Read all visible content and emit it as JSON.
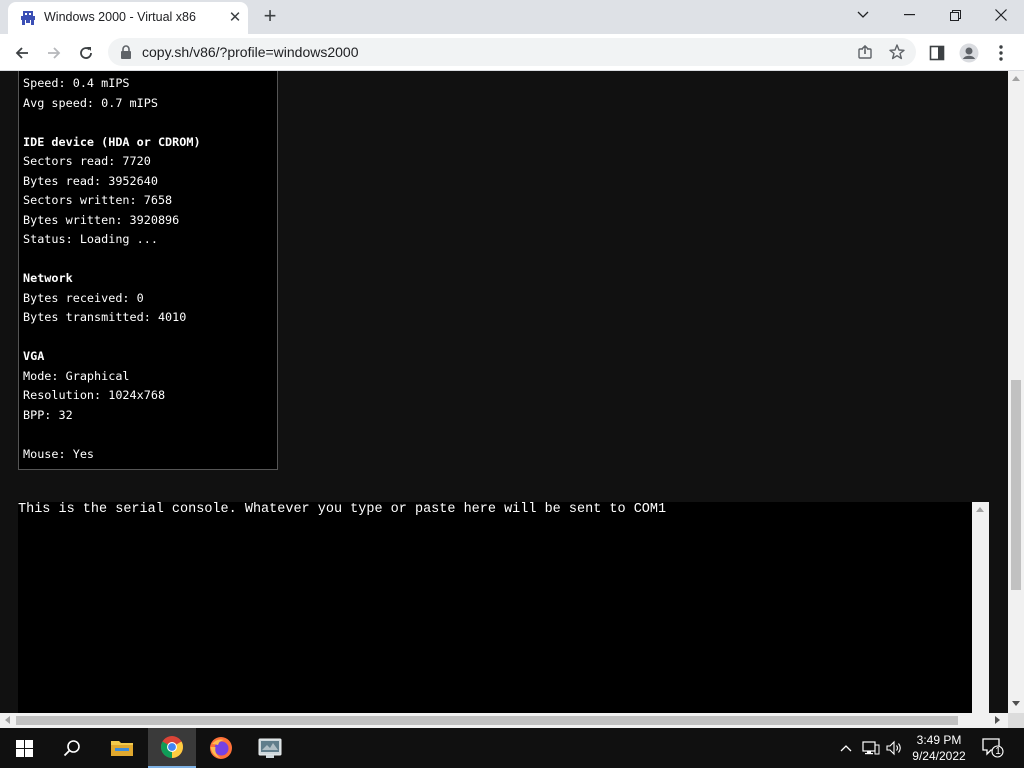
{
  "browser": {
    "tab_title": "Windows 2000 - Virtual x86",
    "url": "copy.sh/v86/?profile=windows2000"
  },
  "info_panel": {
    "lines": [
      {
        "text": "Speed: 0.4 mIPS",
        "bold": false
      },
      {
        "text": "Avg speed: 0.7 mIPS",
        "bold": false
      },
      {
        "text": "",
        "bold": false
      },
      {
        "text": "IDE device (HDA or CDROM)",
        "bold": true
      },
      {
        "text": "Sectors read: 7720",
        "bold": false
      },
      {
        "text": "Bytes read: 3952640",
        "bold": false
      },
      {
        "text": "Sectors written: 7658",
        "bold": false
      },
      {
        "text": "Bytes written: 3920896",
        "bold": false
      },
      {
        "text": "Status: Loading ...",
        "bold": false
      },
      {
        "text": "",
        "bold": false
      },
      {
        "text": "Network",
        "bold": true
      },
      {
        "text": "Bytes received: 0",
        "bold": false
      },
      {
        "text": "Bytes transmitted: 4010",
        "bold": false
      },
      {
        "text": "",
        "bold": false
      },
      {
        "text": "VGA",
        "bold": true
      },
      {
        "text": "Mode: Graphical",
        "bold": false
      },
      {
        "text": "Resolution: 1024x768",
        "bold": false
      },
      {
        "text": "BPP: 32",
        "bold": false
      },
      {
        "text": "",
        "bold": false
      },
      {
        "text": "Mouse: Yes",
        "bold": false
      }
    ]
  },
  "serial_console": {
    "text": "This is the serial console. Whatever you type or paste here will be sent to COM1"
  },
  "taskbar": {
    "apps": [
      {
        "name": "file-explorer-icon",
        "active": false
      },
      {
        "name": "chrome-icon",
        "active": true
      },
      {
        "name": "firefox-icon",
        "active": false
      },
      {
        "name": "app-icon",
        "active": false
      }
    ],
    "time": "3:49 PM",
    "date": "9/24/2022",
    "notification_count": "1"
  },
  "colors": {
    "page_bg": "#111111",
    "panel_bg": "#000000",
    "taskbar_bg": "#101010",
    "accent": "#7fb2e5"
  }
}
